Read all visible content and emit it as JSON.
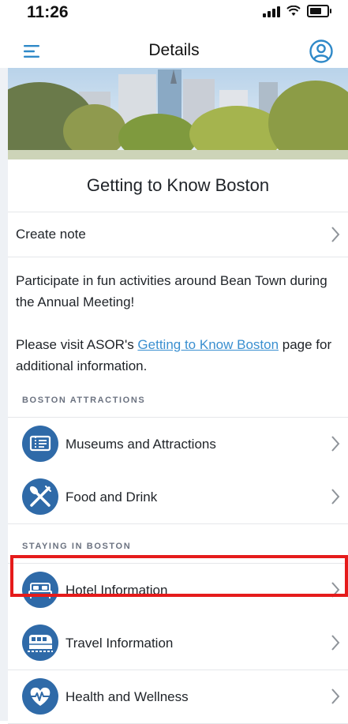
{
  "status_bar": {
    "time": "11:26"
  },
  "nav": {
    "title": "Details"
  },
  "event": {
    "title": "Getting to Know Boston"
  },
  "note_row": {
    "label": "Create note"
  },
  "description": {
    "paragraph1": "Participate in fun activities around Bean Town during the Annual Meeting!",
    "paragraph2_before": "Please visit ASOR's ",
    "paragraph2_link": "Getting to Know Boston",
    "paragraph2_after": " page for additional information."
  },
  "sections": [
    {
      "header": "BOSTON ATTRACTIONS",
      "items": [
        {
          "label": "Museums and Attractions",
          "icon": "ticket-icon"
        },
        {
          "label": "Food and Drink",
          "icon": "fork-knife-icon"
        }
      ]
    },
    {
      "header": "STAYING IN BOSTON",
      "items": [
        {
          "label": "Hotel Information",
          "icon": "bed-icon"
        },
        {
          "label": "Travel Information",
          "icon": "train-icon"
        },
        {
          "label": "Health and Wellness",
          "icon": "heartbeat-icon"
        }
      ]
    }
  ],
  "colors": {
    "accent": "#3a8fd0",
    "icon_blue": "#2f6aa8",
    "highlight": "#e51b1b"
  }
}
